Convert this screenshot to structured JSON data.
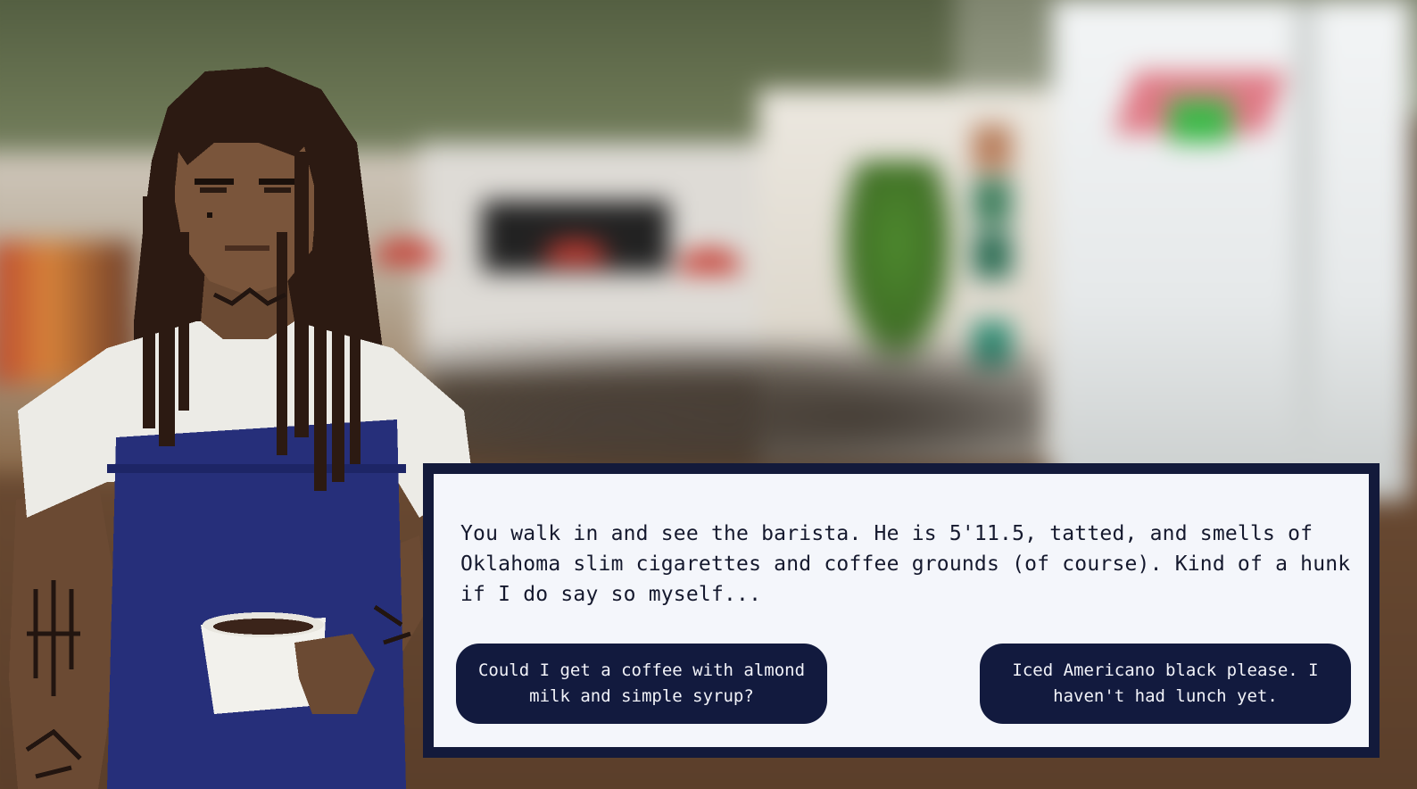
{
  "dialogue": {
    "narration": "You walk in and see the barista. He is 5'11.5, tatted, and smells of Oklahoma slim cigarettes and coffee grounds (of course). Kind of a hunk if I do say so myself...",
    "choices": [
      {
        "label": "Could I get a coffee with almond milk and simple syrup?"
      },
      {
        "label": "Iced Americano black please. I haven't had lunch yet."
      }
    ]
  },
  "colors": {
    "box_border": "#131a3b",
    "box_fill": "#f4f6fb",
    "button_fill": "#121a3e",
    "button_text": "#f1f2f8",
    "apron": "#262f7a"
  },
  "scene": {
    "background": "blurred-cafe-interior",
    "character": "barista-pixel-portrait"
  }
}
